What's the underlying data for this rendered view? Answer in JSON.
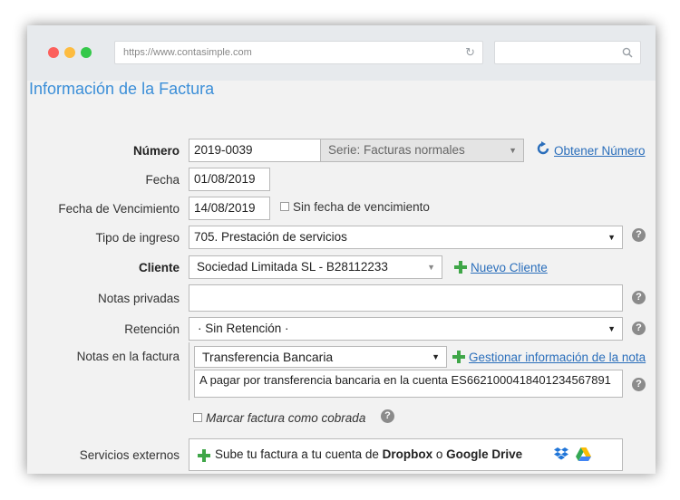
{
  "browser": {
    "url": "https://www.contasimple.com"
  },
  "page": {
    "title": "Información de la Factura"
  },
  "form": {
    "numero": {
      "label": "Número",
      "value": "2019-0039",
      "serie": "Serie: Facturas normales",
      "link": "Obtener Número"
    },
    "fecha": {
      "label": "Fecha",
      "value": "01/08/2019"
    },
    "vencimiento": {
      "label": "Fecha de Vencimiento",
      "value": "14/08/2019",
      "checkbox_label": "Sin fecha de vencimiento"
    },
    "tipo_ingreso": {
      "label": "Tipo de ingreso",
      "value": "705. Prestación de servicios"
    },
    "cliente": {
      "label": "Cliente",
      "value": "Sociedad Limitada SL - B28112233",
      "link": "Nuevo Cliente"
    },
    "notas_privadas": {
      "label": "Notas privadas",
      "value": ""
    },
    "retencion": {
      "label": "Retención",
      "value": "· Sin Retención ·"
    },
    "notas_factura": {
      "label": "Notas en la factura",
      "select_value": "Transferencia Bancaria",
      "link": "Gestionar información de la nota",
      "text": "A pagar por transferencia bancaria en la cuenta ES6621000418401234567891"
    },
    "cobrada": {
      "label": "Marcar factura como cobrada"
    },
    "externos": {
      "label": "Servicios externos",
      "text_prefix": "Sube tu factura a tu cuenta de ",
      "dropbox": "Dropbox",
      "conj": " o ",
      "gdrive": "Google Drive"
    }
  },
  "colors": {
    "accent": "#3c8fd8",
    "link": "#2a6ebb",
    "add_green": "#3fa648"
  }
}
